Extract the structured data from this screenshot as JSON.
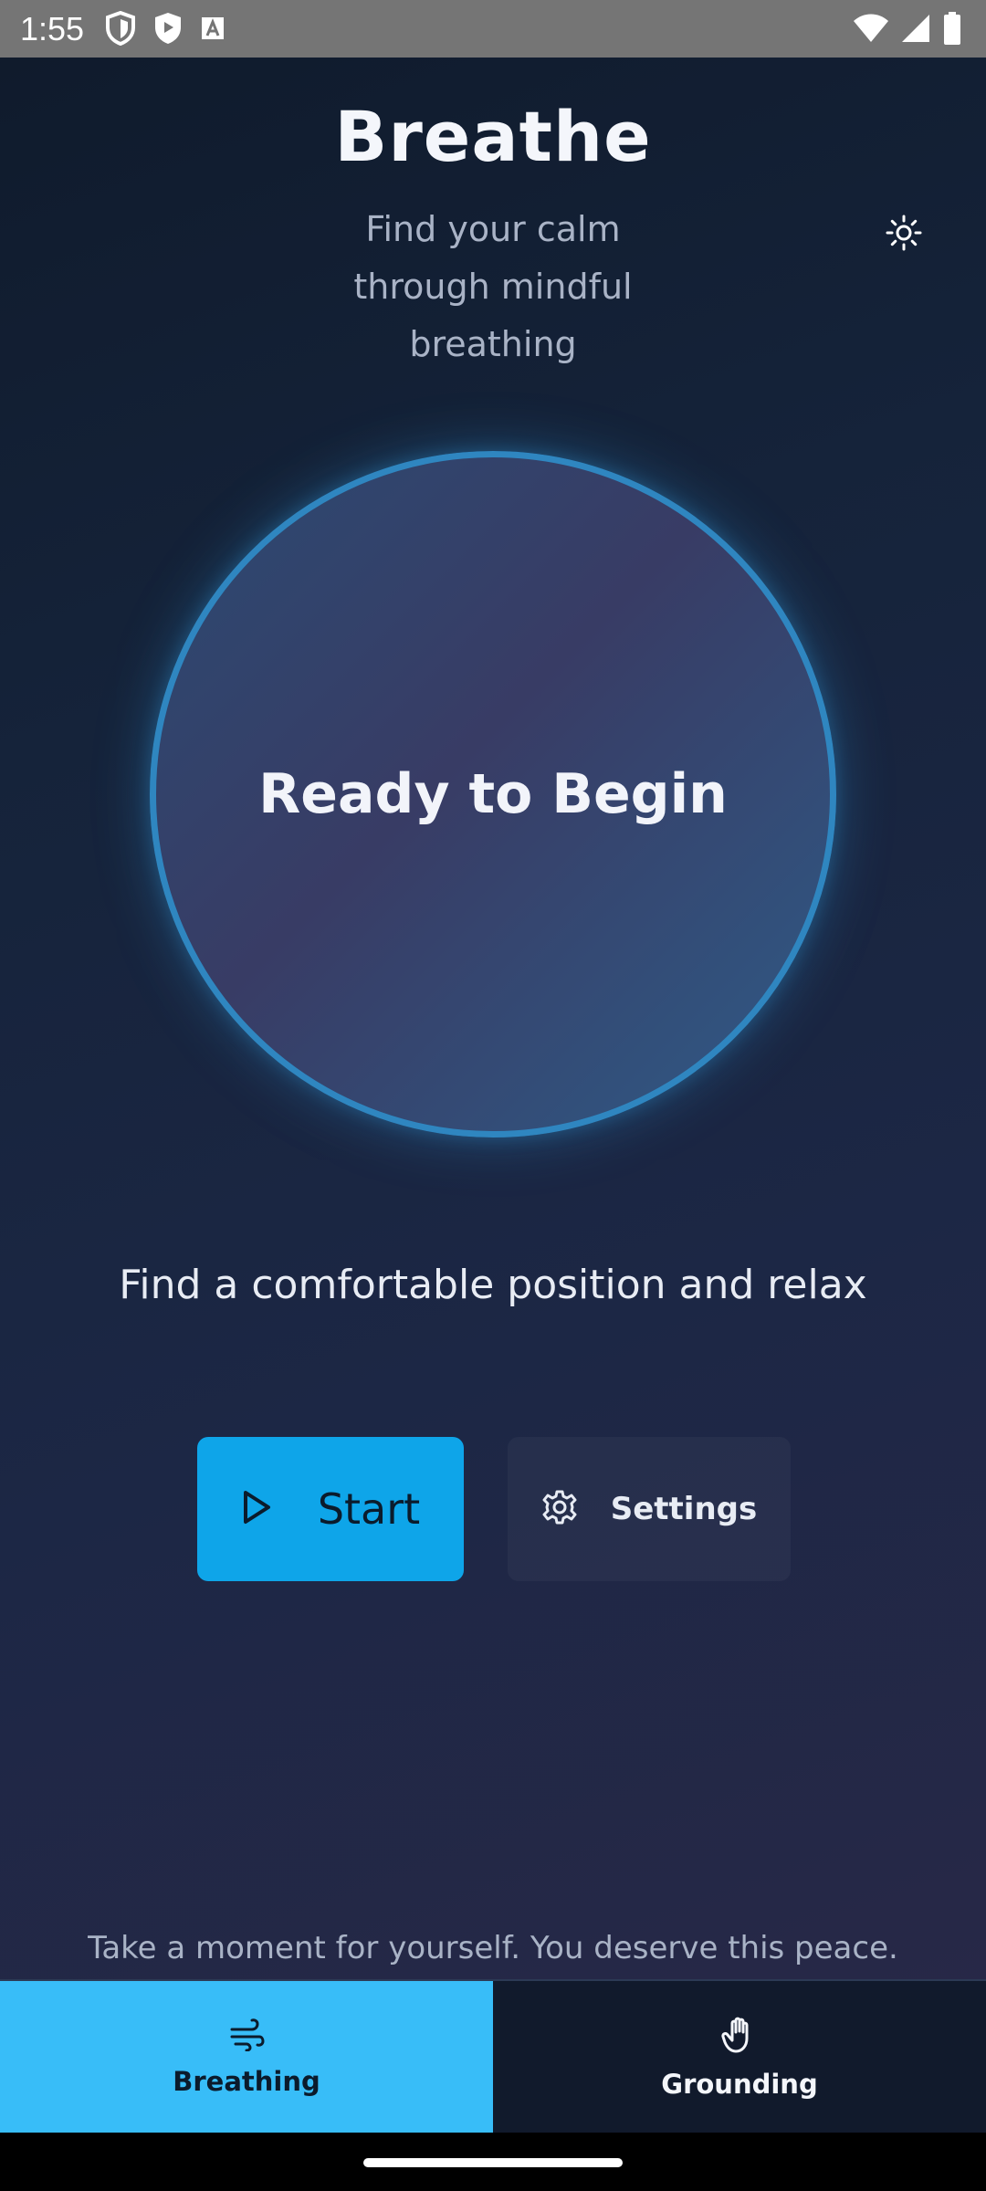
{
  "status_bar": {
    "time": "1:55",
    "left_icons": [
      "shield-icon",
      "play-store-icon",
      "a-icon"
    ],
    "right_icons": [
      "wifi-icon",
      "signal-icon",
      "battery-icon"
    ]
  },
  "header": {
    "title": "Breathe",
    "subtitle": "Find your calm through mindful breathing",
    "theme_toggle_icon": "sun-icon"
  },
  "breath_circle": {
    "label": "Ready to Begin",
    "ring_color": "#2f86c0"
  },
  "instruction": "Find a comfortable position and relax",
  "controls": {
    "start_label": "Start",
    "start_icon": "play-icon",
    "settings_label": "Settings",
    "settings_icon": "gear-icon"
  },
  "footer_quote": "Take a moment for yourself. You deserve this peace.",
  "bottom_nav": {
    "tabs": [
      {
        "label": "Breathing",
        "icon": "wind-icon",
        "active": true
      },
      {
        "label": "Grounding",
        "icon": "hand-icon",
        "active": false
      }
    ]
  },
  "colors": {
    "accent": "#0ea5e9",
    "active_tab": "#38bdf8",
    "inactive_tab": "#111a2c"
  }
}
